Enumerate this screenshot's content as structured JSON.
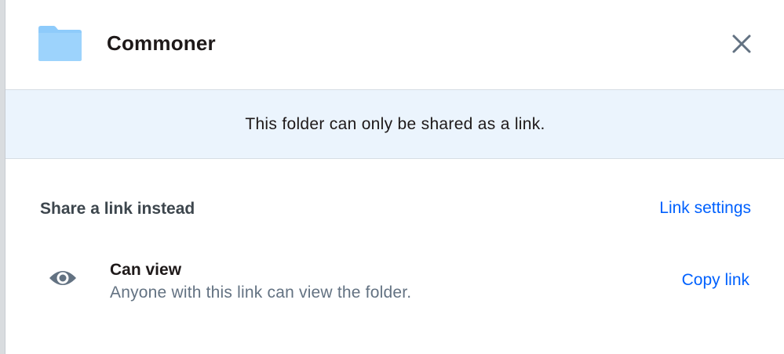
{
  "header": {
    "folder_name": "Commoner",
    "folder_icon": "folder-icon",
    "close_icon": "close-icon"
  },
  "banner": {
    "message": "This folder can only be shared as a link."
  },
  "share": {
    "section_title": "Share a link instead",
    "link_settings_label": "Link settings",
    "permission": {
      "icon": "eye-icon",
      "title": "Can view",
      "description": "Anyone with this link can view the folder.",
      "copy_label": "Copy link"
    }
  },
  "colors": {
    "accent": "#0061fe",
    "folder": "#8ecbfb",
    "banner_bg": "#ebf4fd",
    "muted_text": "#637282"
  }
}
